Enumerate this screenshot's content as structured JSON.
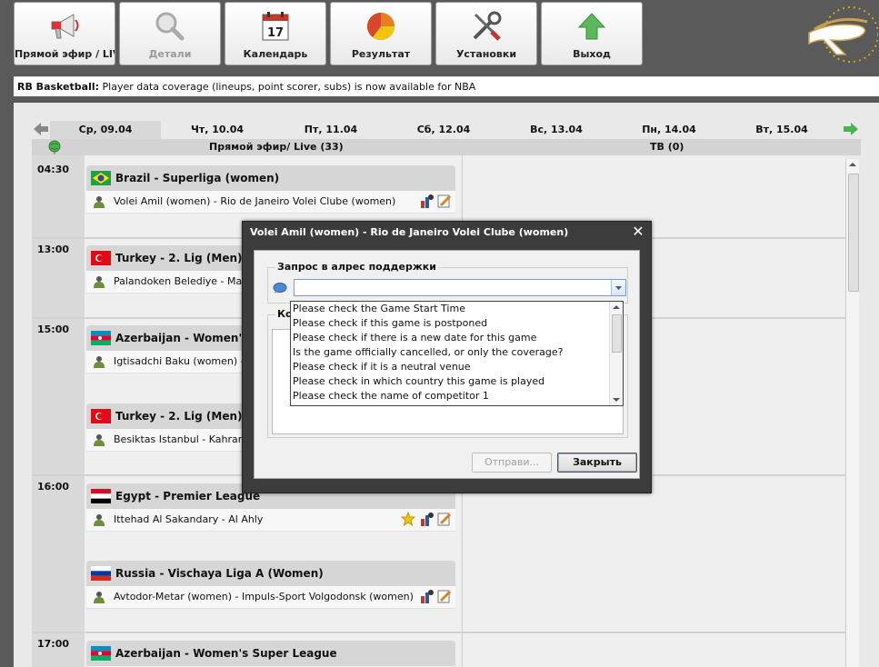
{
  "toolbar": {
    "items": [
      {
        "label": "Прямой эфир / LIVE",
        "icon": "megaphone-icon"
      },
      {
        "label": "Детали",
        "icon": "magnifier-icon",
        "disabled": true
      },
      {
        "label": "Календарь",
        "icon": "calendar-icon",
        "badge": "17"
      },
      {
        "label": "Результат",
        "icon": "pie-chart-icon"
      },
      {
        "label": "Установки",
        "icon": "tools-icon"
      },
      {
        "label": "Выход",
        "icon": "up-arrow-icon"
      }
    ]
  },
  "news": {
    "prefix": "RB Basketball:",
    "text": " Player data coverage (lineups, point scorer, subs) is now available for NBA"
  },
  "days": [
    "Ср, 09.04",
    "Чт, 10.04",
    "Пт, 11.04",
    "Сб, 12.04",
    "Вс, 13.04",
    "Пн, 14.04",
    "Вт, 15.04"
  ],
  "headers": {
    "live": "Прямой эфир/ Live  (33)",
    "tv": "ТВ (0)"
  },
  "times": [
    "04:30",
    "13:00",
    "15:00",
    "16:00",
    "17:00"
  ],
  "cards": [
    {
      "league": "Brazil - Superliga (women)",
      "match": "Volei Amil (women) - Rio de Janeiro Volei Clube (women)",
      "flag": "brazil"
    },
    {
      "league": "Turkey - 2. Lig (Men)",
      "match": "Palandoken Belediye - Maliye",
      "flag": "turkey"
    },
    {
      "league": "Azerbaijan - Women's Su",
      "match": "Igtisadchi Baku (women) - Azu",
      "flag": "azerbaijan"
    },
    {
      "league": "Turkey - 2. Lig (Men)",
      "match": "Besiktas Istanbul - Kahramanm",
      "flag": "turkey"
    },
    {
      "league": "Egypt - Premier League",
      "match": "Ittehad Al Sakandary - Al Ahly",
      "flag": "egypt"
    },
    {
      "league": "Russia - Vischaya Liga A (Women)",
      "match": "Avtodor-Metar (women) - Impuls-Sport Volgodonsk (women)",
      "flag": "russia"
    },
    {
      "league": "Azerbaijan - Women's Super League",
      "match": "",
      "flag": "azerbaijan"
    }
  ],
  "dialog": {
    "title": "Volei Amil (women) - Rio de Janeiro Volei Clube (women)",
    "section1": "Запрос в алрес поддержки",
    "section2": "Комментарий",
    "combo_value": "",
    "options": [
      "Please check the Game Start Time",
      "Please check if this game is postponed",
      "Please check if there is a new date for this game",
      "Is the game officially cancelled, or only the coverage?",
      "Please check if it is a neutral venue",
      "Please check in which country this game is played",
      "Please check the name of competitor 1"
    ],
    "send_label": "Отправи...",
    "close_label": "Закрыть"
  }
}
